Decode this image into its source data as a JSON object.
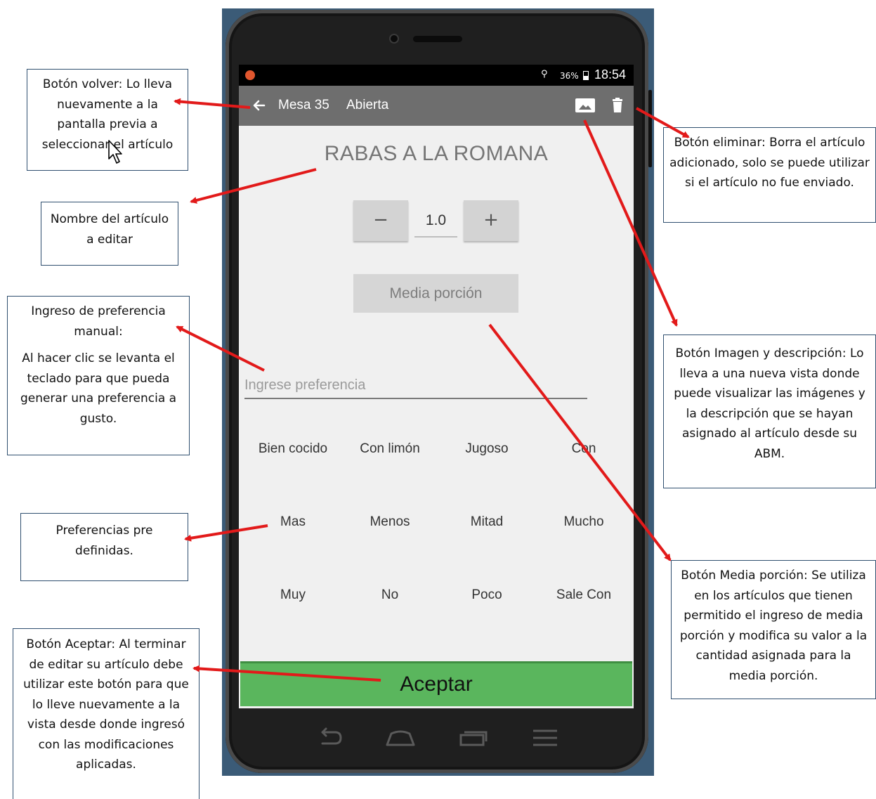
{
  "status_bar": {
    "battery": "36%",
    "time": "18:54"
  },
  "app_bar": {
    "title": "Mesa 35",
    "status": "Abierta",
    "back_icon": "arrow-left-icon",
    "image_icon": "image-icon",
    "delete_icon": "trash-icon"
  },
  "item": {
    "name": "RABAS A LA ROMANA"
  },
  "quantity": {
    "minus_label": "−",
    "value": "1.0",
    "plus_label": "+"
  },
  "half_portion": {
    "label": "Media porción"
  },
  "preference_input": {
    "placeholder": "Ingrese preferencia",
    "value": ""
  },
  "presets": [
    "Bien cocido",
    "Con limón",
    "Jugoso",
    "Con",
    "Mas",
    "Menos",
    "Mitad",
    "Mucho",
    "Muy",
    "No",
    "Poco",
    "Sale Con"
  ],
  "accept": {
    "label": "Aceptar",
    "color": "#5ab65d"
  },
  "nav_bar": {
    "icons": [
      "back-nav-icon",
      "home-icon",
      "recents-icon",
      "menu-icon"
    ]
  },
  "annotations": {
    "back": "Botón volver: Lo lleva nuevamente a la pantalla previa a seleccionar el artículo",
    "name": "Nombre del artículo a editar",
    "manual_title": "Ingreso de preferencia manual:",
    "manual_body": "Al hacer clic se levanta el teclado para que pueda generar una preferencia a gusto.",
    "presets": "Preferencias pre definidas.",
    "accept": "Botón Aceptar: Al terminar de editar su artículo debe utilizar este botón para que lo lleve nuevamente a la vista desde donde ingresó con las modificaciones aplicadas.",
    "delete": "Botón eliminar: Borra el artículo adicionado, solo se puede utilizar si el artículo no fue enviado.",
    "image": "Botón Imagen y descripción: Lo lleva a una nueva vista donde puede visualizar las imágenes y la descripción que se hayan asignado al artículo desde su ABM.",
    "half": "Botón Media porción: Se utiliza en los artículos que tienen permitido el ingreso de media porción y modifica su valor a la cantidad asignada para la media porción."
  },
  "colors": {
    "arrow": "#e21a1a",
    "app_bar": "#6e6e6e",
    "screen_bg": "#f0f0f0"
  }
}
